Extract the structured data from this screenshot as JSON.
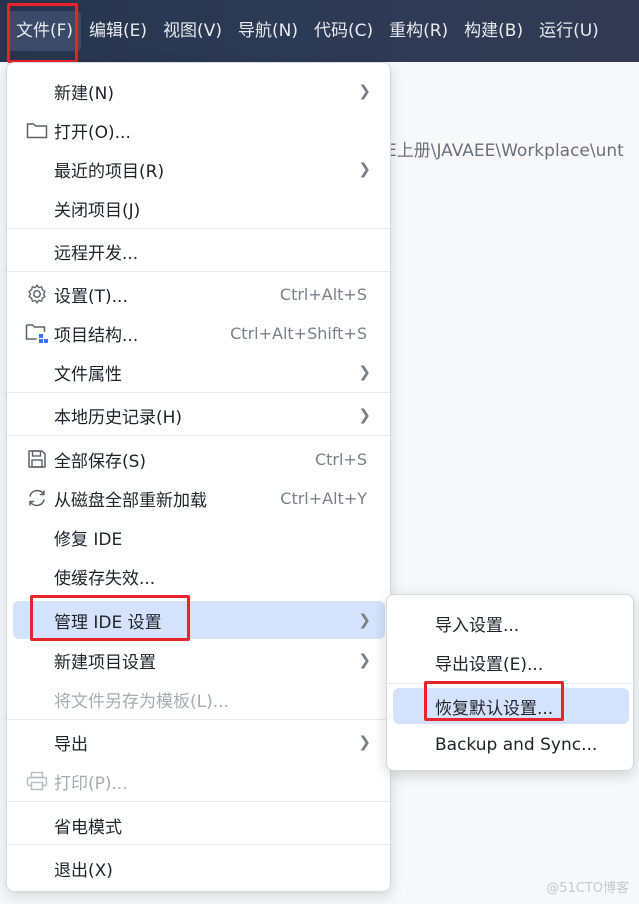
{
  "menubar": {
    "items": [
      "文件(F)",
      "编辑(E)",
      "视图(V)",
      "导航(N)",
      "代码(C)",
      "重构(R)",
      "构建(B)",
      "运行(U)"
    ]
  },
  "background": {
    "path_text": "E上册\\JAVAEE\\Workplace\\unt"
  },
  "file_menu": {
    "new": "新建(N)",
    "open": "打开(O)...",
    "recent": "最近的项目(R)",
    "close": "关闭项目(J)",
    "remote": "远程开发...",
    "settings": "设置(T)...",
    "settings_shortcut": "Ctrl+Alt+S",
    "structure": "项目结构...",
    "structure_shortcut": "Ctrl+Alt+Shift+S",
    "properties": "文件属性",
    "local_history": "本地历史记录(H)",
    "save_all": "全部保存(S)",
    "save_all_shortcut": "Ctrl+S",
    "reload": "从磁盘全部重新加载",
    "reload_shortcut": "Ctrl+Alt+Y",
    "repair": "修复 IDE",
    "invalidate": "使缓存失效...",
    "manage_ide": "管理 IDE 设置",
    "new_project_settings": "新建项目设置",
    "save_as_template": "将文件另存为模板(L)...",
    "export": "导出",
    "print": "打印(P)...",
    "power_save": "省电模式",
    "exit": "退出(X)"
  },
  "submenu": {
    "import": "导入设置...",
    "export": "导出设置(E)...",
    "restore": "恢复默认设置...",
    "backup": "Backup and Sync..."
  },
  "watermark": "@51CTO博客",
  "colors": {
    "menubar_bg": "#2d3a55",
    "highlight": "#d4e2fb",
    "annotation_red": "#e8232b"
  }
}
